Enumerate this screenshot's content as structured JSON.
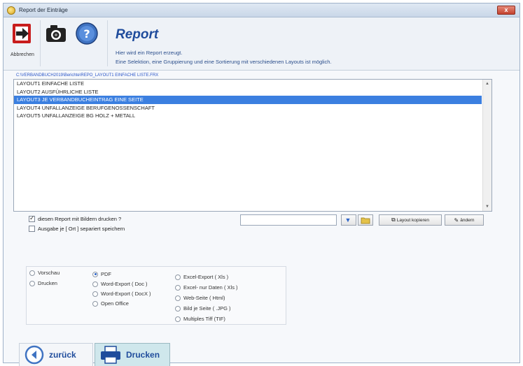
{
  "window": {
    "title": "Report der Einträge",
    "close_label": "x"
  },
  "toolbar": {
    "exit_caption": "Abbrechen"
  },
  "header": {
    "title": "Report",
    "desc_line1": "Hier wird ein Report erzeugt.",
    "desc_line2": "Eine Selektion, eine Gruppierung und eine Sortierung mit verschiedenen Layouts ist möglich."
  },
  "path": "C:\\VERBANDBUCH2019\\Berichte\\REPO_LAYOUT1 EINFACHE LISTE.FRX",
  "layouts": [
    {
      "label": "LAYOUT1 EINFACHE LISTE"
    },
    {
      "label": "LAYOUT2 AUSFÜHRLICHE LISTE"
    },
    {
      "label": "LAYOUT3  JE VERBANDBUCHEINTRAG EINE SEITE"
    },
    {
      "label": "LAYOUT4  UNFALLANZEIGE BERUFGENOSSENSCHAFT"
    },
    {
      "label": "LAYOUT5  UNFALLANZEIGE BG HOLZ + METALL"
    }
  ],
  "selected_layout_index": 2,
  "options": {
    "print_images_label": "diesen Report mit Bildern drucken ?",
    "print_images_checked": true,
    "separate_label": "Ausgabe je [ Ort ] separiert speichern",
    "separate_checked": false
  },
  "tool_buttons": {
    "copy_layout_label": "Layout kopieren",
    "edit_label": "ändern"
  },
  "output": {
    "col1": [
      "Vorschau",
      "Drucken"
    ],
    "col2": [
      "PDF",
      "Word-Export ( Doc )",
      "Word-Export ( DocX )",
      "Open Office"
    ],
    "col3": [
      "Excel-Export ( Xls )",
      "Excel- nur Daten ( Xls )",
      "Web-Seite ( Html)",
      "Bild je Seite ( .JPG )",
      "Multiples Tiff (TIF)"
    ],
    "selected": "PDF"
  },
  "buttons": {
    "back_label": "zurück",
    "print_label": "Drucken"
  }
}
